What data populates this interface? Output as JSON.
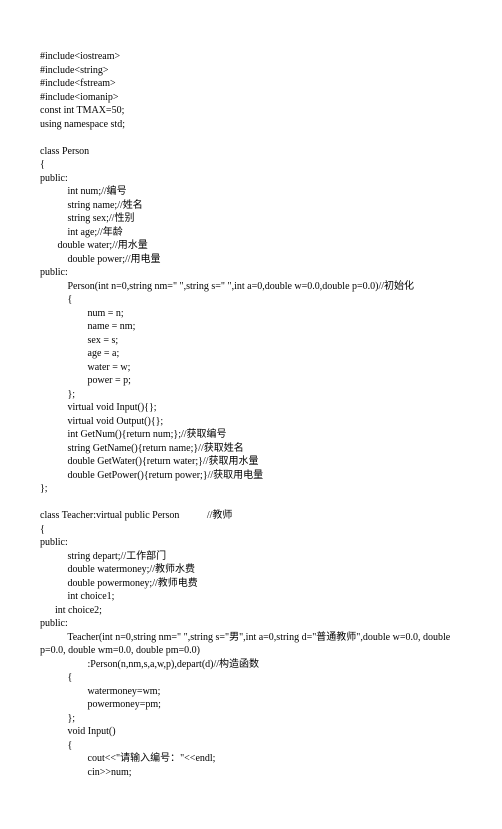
{
  "lines": [
    "#include<iostream>",
    "#include<string>",
    "#include<fstream>",
    "#include<iomanip>",
    "const int TMAX=50;",
    "using namespace std;",
    "",
    "class Person",
    "{",
    "public:",
    "           int num;//编号",
    "           string name;//姓名",
    "           string sex;//性别",
    "           int age;//年龄",
    "       double water;//用水量",
    "           double power;//用电量",
    "public:",
    "           Person(int n=0,string nm=\" \",string s=\" \",int a=0,double w=0.0,double p=0.0)//初始化",
    "           {",
    "                   num = n;",
    "                   name = nm;",
    "                   sex = s;",
    "                   age = a;",
    "                   water = w;",
    "                   power = p;",
    "           };",
    "           virtual void Input(){};",
    "           virtual void Output(){};",
    "           int GetNum(){return num;};//获取编号",
    "           string GetName(){return name;}//获取姓名",
    "           double GetWater(){return water;}//获取用水量",
    "           double GetPower(){return power;}//获取用电量",
    "};",
    "",
    "class Teacher:virtual public Person           //教师",
    "{",
    "public:",
    "           string depart;//工作部门",
    "           double watermoney;//教师水费",
    "           double powermoney;//教师电费",
    "           int choice1;",
    "      int choice2;",
    "public:",
    "           Teacher(int n=0,string nm=\" \",string s=\"男\",int a=0,string d=\"普通教师\",double w=0.0, double",
    "p=0.0, double wm=0.0, double pm=0.0)",
    "                   :Person(n,nm,s,a,w,p),depart(d)//构造函数",
    "           {",
    "                   watermoney=wm;",
    "                   powermoney=pm;",
    "           };",
    "           void Input()",
    "           {",
    "                   cout<<\"请输入编号：\"<<endl;",
    "                   cin>>num;"
  ]
}
